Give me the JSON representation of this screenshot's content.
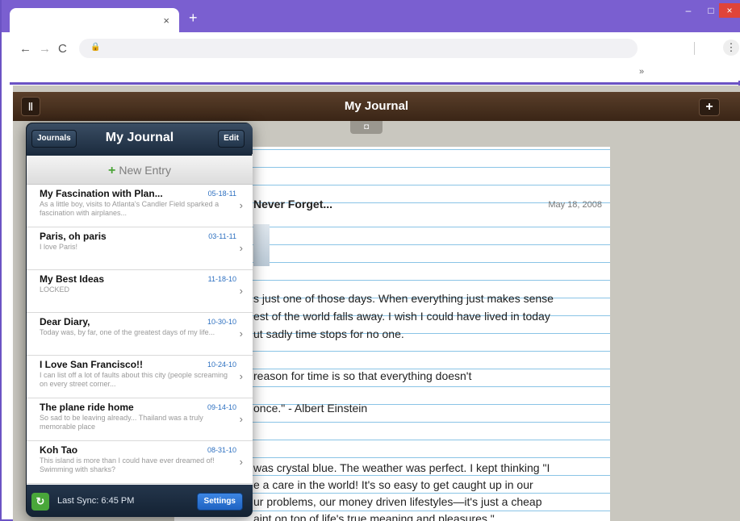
{
  "browser": {
    "tab_close": "×",
    "new_tab": "+",
    "back": "←",
    "forward": "→",
    "reload": "C",
    "lock": "🔒",
    "menu": "⋮",
    "overflow": "»",
    "win_min": "–",
    "win_max": "□",
    "win_close": "×"
  },
  "app": {
    "title": "My Journal",
    "journals_icon": "Ⅱ",
    "add_icon": "+",
    "camera_icon": "◘"
  },
  "paper": {
    "title": "Never Forget...",
    "date": "May 18, 2008",
    "lines": [
      "s just one of those days. When everything just makes sense",
      "est of the world falls away. I wish I could have lived in today",
      "ut sadly time stops for no one.",
      "reason for time is so that everything doesn't",
      "once.\"   - Albert Einstein",
      "was crystal blue. The weather was perfect. I kept thinking \"I",
      "e a care in the world! It's so easy to get caught up in our",
      "ur problems, our money driven lifestyles—it's just a cheap",
      "aint on top of life's true meaning and pleasures.\""
    ]
  },
  "popover": {
    "title": "My Journal",
    "journals_btn": "Journals",
    "edit_btn": "Edit",
    "new_entry": "New Entry",
    "entries": [
      {
        "title": "My Fascination with Plan...",
        "date": "05-18-11",
        "snippet": "As a little boy, visits to Atlanta's Candler Field sparked a fascination with airplanes..."
      },
      {
        "title": "Paris, oh paris",
        "date": "03-11-11",
        "snippet": "I love Paris!"
      },
      {
        "title": "My Best Ideas",
        "date": "11-18-10",
        "snippet": "LOCKED"
      },
      {
        "title": "Dear Diary,",
        "date": "10-30-10",
        "snippet": "Today was, by far, one of the greatest days of my life..."
      },
      {
        "title": "I Love San Francisco!!",
        "date": "10-24-10",
        "snippet": "I can list off a lot of faults about this city (people screaming on every street corner..."
      },
      {
        "title": "The plane ride home",
        "date": "09-14-10",
        "snippet": "So sad to be leaving already... Thailand was a truly memorable place"
      },
      {
        "title": "Koh Tao",
        "date": "08-31-10",
        "snippet": "This island is more than I could have ever dreamed of! Swimming with sharks?"
      }
    ],
    "sync_text": "Last Sync: 6:45 PM",
    "settings_btn": "Settings"
  },
  "colors": {
    "browser_frame": "#7a5fd0",
    "app_header": "#4a3220",
    "accent_blue": "#2c6fc0",
    "sync_green": "#49a73a"
  }
}
